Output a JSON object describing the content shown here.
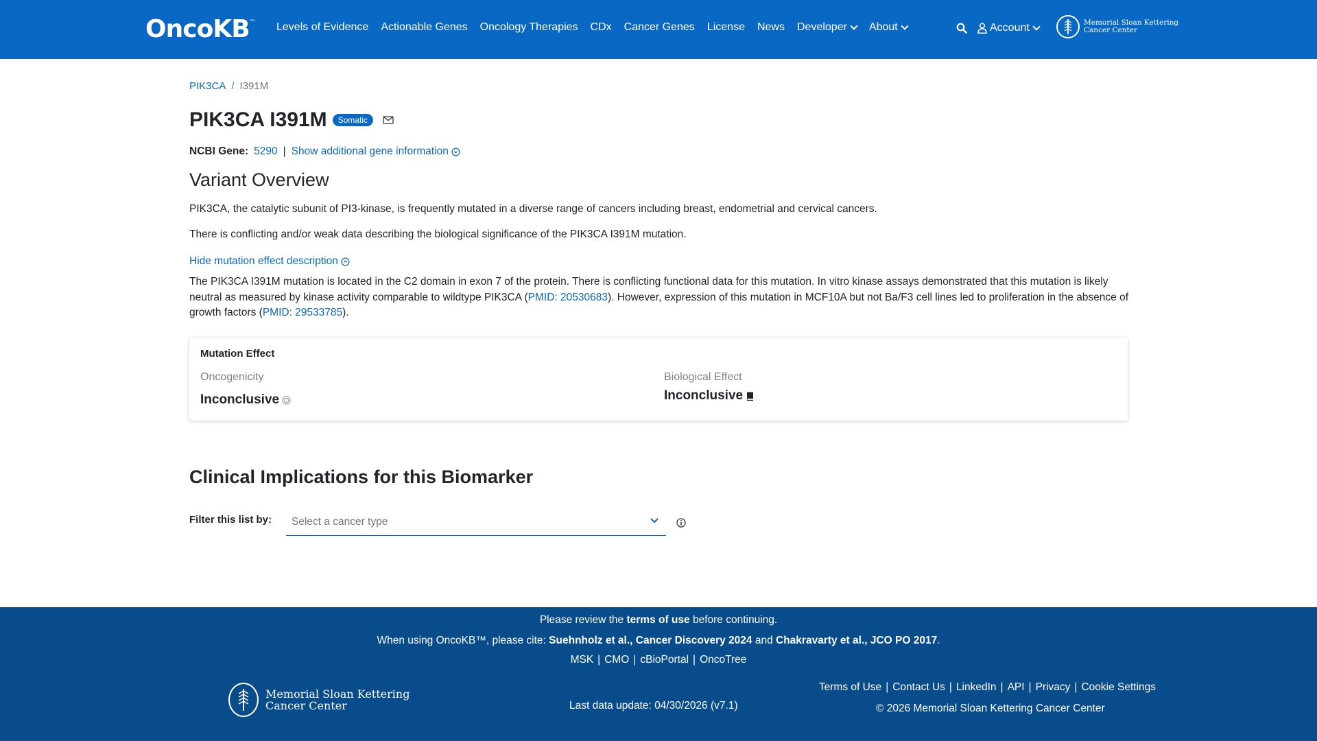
{
  "header": {
    "logo": "OncoKB",
    "logo_tm": "™",
    "nav": [
      {
        "label": "Levels of Evidence"
      },
      {
        "label": "Actionable Genes"
      },
      {
        "label": "Oncology Therapies"
      },
      {
        "label": "CDx"
      },
      {
        "label": "Cancer Genes"
      },
      {
        "label": "License"
      },
      {
        "label": "News"
      },
      {
        "label": "Developer"
      },
      {
        "label": "About"
      }
    ],
    "account_label": "Account",
    "msk_line1": "Memorial Sloan Kettering",
    "msk_line2": "Cancer Center",
    "bg_color": "#0968c3"
  },
  "breadcrumb": {
    "gene": "PIK3CA",
    "separator": "/",
    "current": "I391M"
  },
  "title": {
    "text": "PIK3CA I391M",
    "badge": "Somatic"
  },
  "gene_info": {
    "label": "NCBI Gene:",
    "value": "5290",
    "separator": "|",
    "toggle": "Show additional gene information"
  },
  "overview": {
    "heading": "Variant Overview",
    "p1": "PIK3CA, the catalytic subunit of PI3-kinase, is frequently mutated in a diverse range of cancers including breast, endometrial and cervical cancers.",
    "p2": "There is conflicting and/or weak data describing the biological significance of the PIK3CA I391M mutation.",
    "hide_link": "Hide mutation effect description",
    "p3_a": "The PIK3CA I391M mutation is located in the C2 domain in exon 7 of the protein. There is conflicting functional data for this mutation. In vitro kinase assays demonstrated that this mutation is likely neutral as measured by kinase activity comparable to wildtype PIK3CA (",
    "p3_pmid1": "PMID: 20530683",
    "p3_b": "). However, expression of this mutation in MCF10A but not Ba/F3 cell lines led to proliferation in the absence of growth factors (",
    "p3_pmid2": "PMID: 29533785",
    "p3_c": ")."
  },
  "mutation_effect": {
    "title": "Mutation Effect",
    "oncogenicity_label": "Oncogenicity",
    "oncogenicity_value": "Inconclusive",
    "biological_label": "Biological Effect",
    "biological_value": "Inconclusive"
  },
  "clinical": {
    "heading": "Clinical Implications for this Biomarker",
    "filter_label": "Filter this list by:",
    "select_placeholder": "Select a cancer type"
  },
  "footer": {
    "review_a": "Please review the ",
    "review_b": "terms of use",
    "review_c": " before continuing.",
    "cite_a": "When using OncoKB™, please cite: ",
    "cite_b": "Suehnholz et al., Cancer Discovery 2024",
    "cite_c": " and ",
    "cite_d": "Chakravarty et al., JCO PO 2017",
    "cite_e": ".",
    "links": [
      "MSK",
      "CMO",
      "cBioPortal",
      "OncoTree"
    ],
    "msk_line1": "Memorial Sloan Kettering",
    "msk_line2": "Cancer Center",
    "last_update": "Last data update: 04/30/2026 (v7.1)",
    "right_links": [
      "Terms of Use",
      "Contact Us",
      "LinkedIn",
      "API",
      "Privacy",
      "Cookie Settings"
    ],
    "copyright": "© 2026 Memorial Sloan Kettering Cancer Center",
    "bg_color": "#084c8c"
  }
}
